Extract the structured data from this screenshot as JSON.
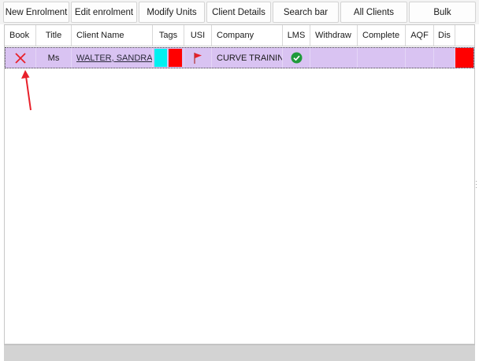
{
  "toolbar": {
    "buttons": [
      {
        "label": "New Enrolment"
      },
      {
        "label": "Edit enrolment"
      },
      {
        "label": "Modify Units"
      },
      {
        "label": "Client Details"
      },
      {
        "label": "Search bar"
      },
      {
        "label": "All Clients"
      },
      {
        "label": "Bulk"
      }
    ]
  },
  "table": {
    "columns": [
      "Book",
      "Title",
      "Client Name",
      "Tags",
      "USI",
      "Company",
      "LMS",
      "Withdraw",
      "Complete",
      "AQF",
      "Dis"
    ],
    "rows": [
      {
        "book_icon": "red-x-icon",
        "title": "Ms",
        "client_name": "WALTER, SANDRA",
        "tags": [
          "#00f0f0",
          "#ff0000"
        ],
        "usi_icon": "red-flag-icon",
        "company": "CURVE TRAINING",
        "lms_icon": "green-check-icon",
        "withdraw": "",
        "complete": "",
        "aqf": "",
        "dis_color": "#ff0000"
      }
    ]
  },
  "colors": {
    "row_selected": "#d9c3f2",
    "annotation_arrow": "#e8202a"
  }
}
